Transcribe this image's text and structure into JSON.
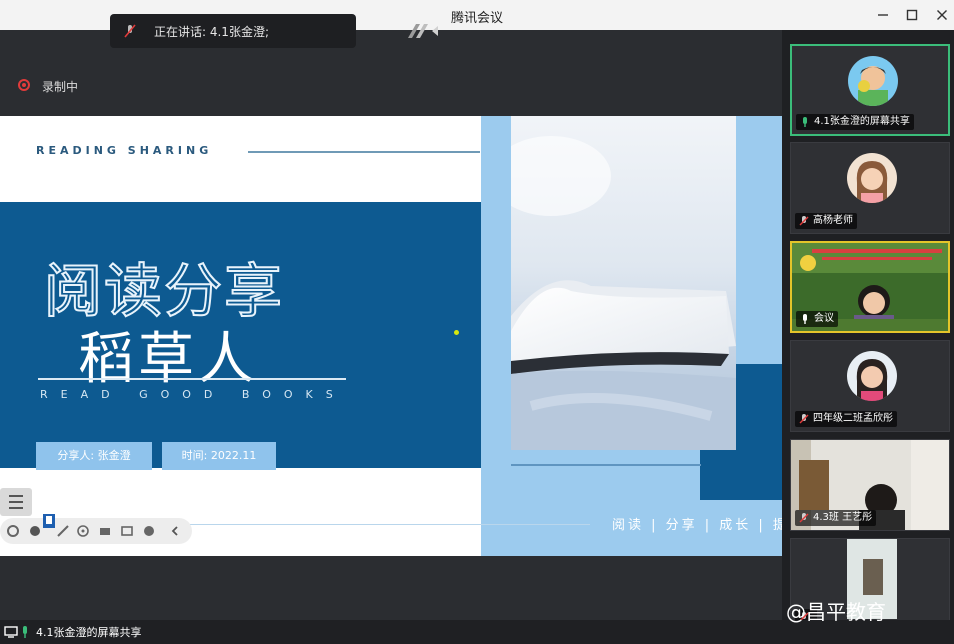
{
  "window": {
    "title": "腾讯会议"
  },
  "speaking": {
    "text": "正在讲话: 4.1张金澄;"
  },
  "recording": {
    "label": "录制中"
  },
  "slide": {
    "reading_sharing": "READING SHARING",
    "title_outline": "阅读分享",
    "title_main": "稻草人",
    "read_good_books": "READ GOOD BOOKS",
    "chip_sharer": "分享人: 张金澄",
    "chip_time": "时间: 2022.11",
    "footer": "阅读 | 分享 | 成长 | 提升"
  },
  "participants": [
    {
      "name": "4.1张金澄的屏幕共享",
      "mic": "on",
      "state": "active"
    },
    {
      "name": "高杨老师",
      "mic": "muted",
      "state": "normal"
    },
    {
      "name": "会议",
      "mic": "on",
      "state": "speaking"
    },
    {
      "name": "四年级二班孟欣彤",
      "mic": "muted",
      "state": "normal"
    },
    {
      "name": "4.3班 王艺彤",
      "mic": "muted",
      "state": "normal"
    },
    {
      "name": "",
      "mic": "muted",
      "state": "normal"
    }
  ],
  "bottom": {
    "share_label": "4.1张金澄的屏幕共享"
  },
  "watermark": "@昌平教育",
  "colors": {
    "slide_blue": "#0d5a91",
    "slide_light_blue": "#9ccbee",
    "active_border": "#3bbd7a",
    "speaking_border": "#e4c52a",
    "recording_red": "#e03b3b"
  }
}
